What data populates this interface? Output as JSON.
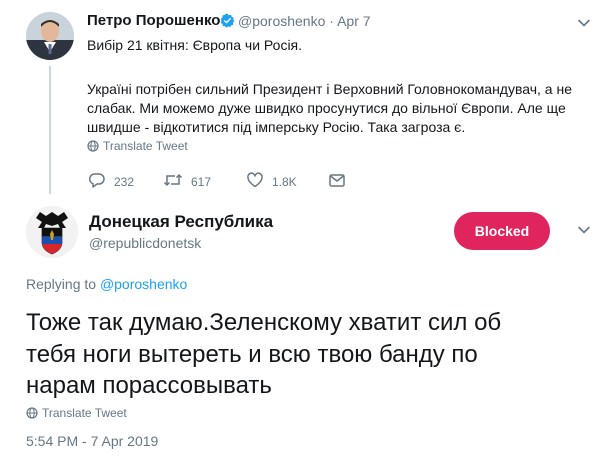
{
  "parent_tweet": {
    "author_name": "Петро Порошенко",
    "handle": "@poroshenko",
    "separator": "·",
    "date": "Apr 7",
    "lines": [
      "Вибір 21 квітня: Європа чи Росія.",
      "",
      "Україні потрібен сильний Президент і Верховний Головнокомандувач, а не",
      "слабак. Ми можемо дуже швидко просунутися до вільної Європи. Але ще",
      "швидше - відкотитися під імперську Росію. Така загроза є."
    ],
    "translate_label": "Translate Tweet",
    "reply_count": "232",
    "retweet_count": "617",
    "like_count": "1.8K"
  },
  "reply_tweet": {
    "author_name": "Донецкая Республика",
    "handle": "@republicdonetsk",
    "blocked_label": "Blocked",
    "replying_prefix": "Replying to",
    "replying_to": "@poroshenko",
    "lines": [
      "Тоже так думаю.Зеленскому хватит сил об",
      "тебя ноги вытереть и всю твою банду по",
      "нарам порассовывать"
    ],
    "translate_label": "Translate Tweet",
    "timestamp": "5:54 PM - 7 Apr 2019"
  },
  "colors": {
    "text": "#14171a",
    "secondary": "#657786",
    "link": "#1da1f2",
    "blocked": "#e0245e",
    "verified": "#1da1f2"
  },
  "icons": [
    "verified-badge-icon",
    "chevron-down-icon",
    "globe-icon",
    "reply-icon",
    "retweet-icon",
    "like-icon",
    "dm-icon",
    "emblem-icon"
  ]
}
